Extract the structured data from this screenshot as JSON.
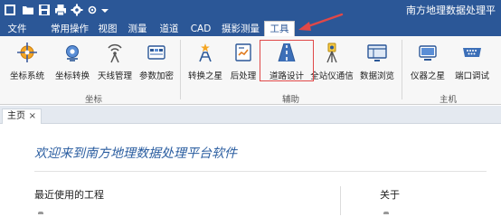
{
  "app": {
    "title": "南方地理数据处理平"
  },
  "quick_access": [
    "app-icon",
    "open-folder-icon",
    "save-icon",
    "print-icon",
    "settings-icon",
    "quick-access-icon",
    "customize-dropdown-icon"
  ],
  "ribbon_tabs": [
    {
      "label": "文件"
    },
    {
      "label": "常用操作"
    },
    {
      "label": "视图"
    },
    {
      "label": "测量"
    },
    {
      "label": "道道"
    },
    {
      "label": "CAD"
    },
    {
      "label": "摄影测量"
    },
    {
      "label": "工具"
    }
  ],
  "active_tab": "工具",
  "groups": {
    "coord": {
      "label": "坐标",
      "buttons": [
        {
          "label": "坐标系统"
        },
        {
          "label": "坐标转换"
        },
        {
          "label": "天线管理"
        },
        {
          "label": "参数加密"
        }
      ]
    },
    "aux": {
      "label": "辅助",
      "buttons": [
        {
          "label": "转换之星"
        },
        {
          "label": "后处理"
        },
        {
          "label": "道路设计"
        },
        {
          "label": "全站仪通信"
        },
        {
          "label": "数据浏览"
        }
      ]
    },
    "host": {
      "label": "主机",
      "buttons": [
        {
          "label": "仪器之星"
        },
        {
          "label": "端口调试"
        }
      ]
    }
  },
  "doc_tabs": [
    {
      "label": "主页",
      "close": "×"
    }
  ],
  "home": {
    "welcome": "欢迎来到南方地理数据处理平台软件",
    "recent_title": "最近使用的工程",
    "about_title": "关于"
  },
  "colors": {
    "title_bar": "#2b5797",
    "highlight": "#e04848",
    "welcome_text": "#2a5da0"
  }
}
